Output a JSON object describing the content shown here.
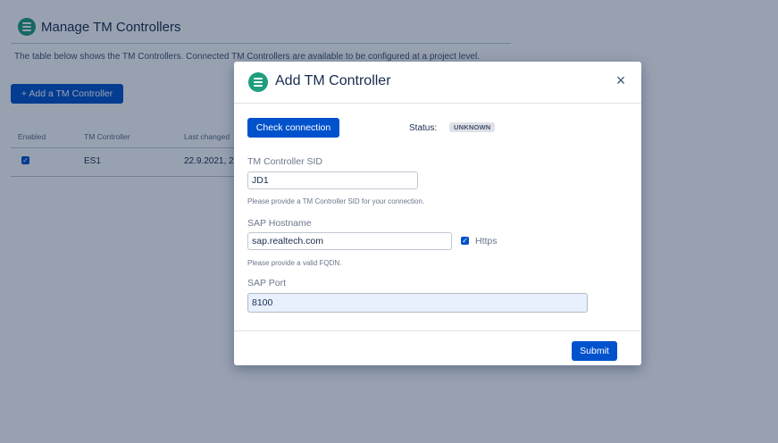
{
  "page": {
    "title": "Manage TM Controllers",
    "description": "The table below shows the TM Controllers. Connected TM Controllers are available to be configured at a project level.",
    "add_button_label": "+ Add a TM Controller",
    "table": {
      "headers": [
        "Enabled",
        "TM Controller",
        "Last changed"
      ],
      "rows": [
        {
          "enabled": true,
          "controller": "ES1",
          "last_changed": "22.9.2021, 2"
        }
      ]
    }
  },
  "modal": {
    "title": "Add TM Controller",
    "close_icon": "×",
    "check_connection_label": "Check connection",
    "status_label": "Status:",
    "status_value": "UNKNOWN",
    "fields": {
      "sid": {
        "label": "TM Controller SID",
        "value": "JD1",
        "help": "Please provide a TM Controller SID for your connection."
      },
      "hostname": {
        "label": "SAP Hostname",
        "value": "sap.realtech.com",
        "help": "Please provide a valid FQDN.",
        "https_label": "Https",
        "https_checked": true
      },
      "port": {
        "label": "SAP Port",
        "value": "8100"
      }
    },
    "submit_label": "Submit"
  },
  "colors": {
    "primary": "#0052cc",
    "logo": "#1f9e7f",
    "overlay": "rgba(9,30,66,0.42)"
  }
}
